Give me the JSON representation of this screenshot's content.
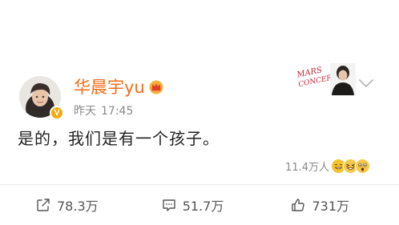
{
  "user": {
    "name": "华晨宇yu",
    "time": "昨天",
    "clock": "17:45",
    "verified": true,
    "name_color": "#f26d1b"
  },
  "post": {
    "text": "是的，我们是有一个孩子。"
  },
  "card": {
    "label": "MARS CONCERT"
  },
  "reactions": {
    "count": "11.4万人",
    "emojis": [
      "grin-sweat-emoji",
      "squint-laugh-emoji",
      "shocked-emoji"
    ]
  },
  "actions": {
    "share": "78.3万",
    "comment": "51.7万",
    "like": "731万"
  },
  "colors": {
    "accent": "#f26d1b",
    "muted": "#8a8a8a",
    "badge": "#f4a90c"
  }
}
